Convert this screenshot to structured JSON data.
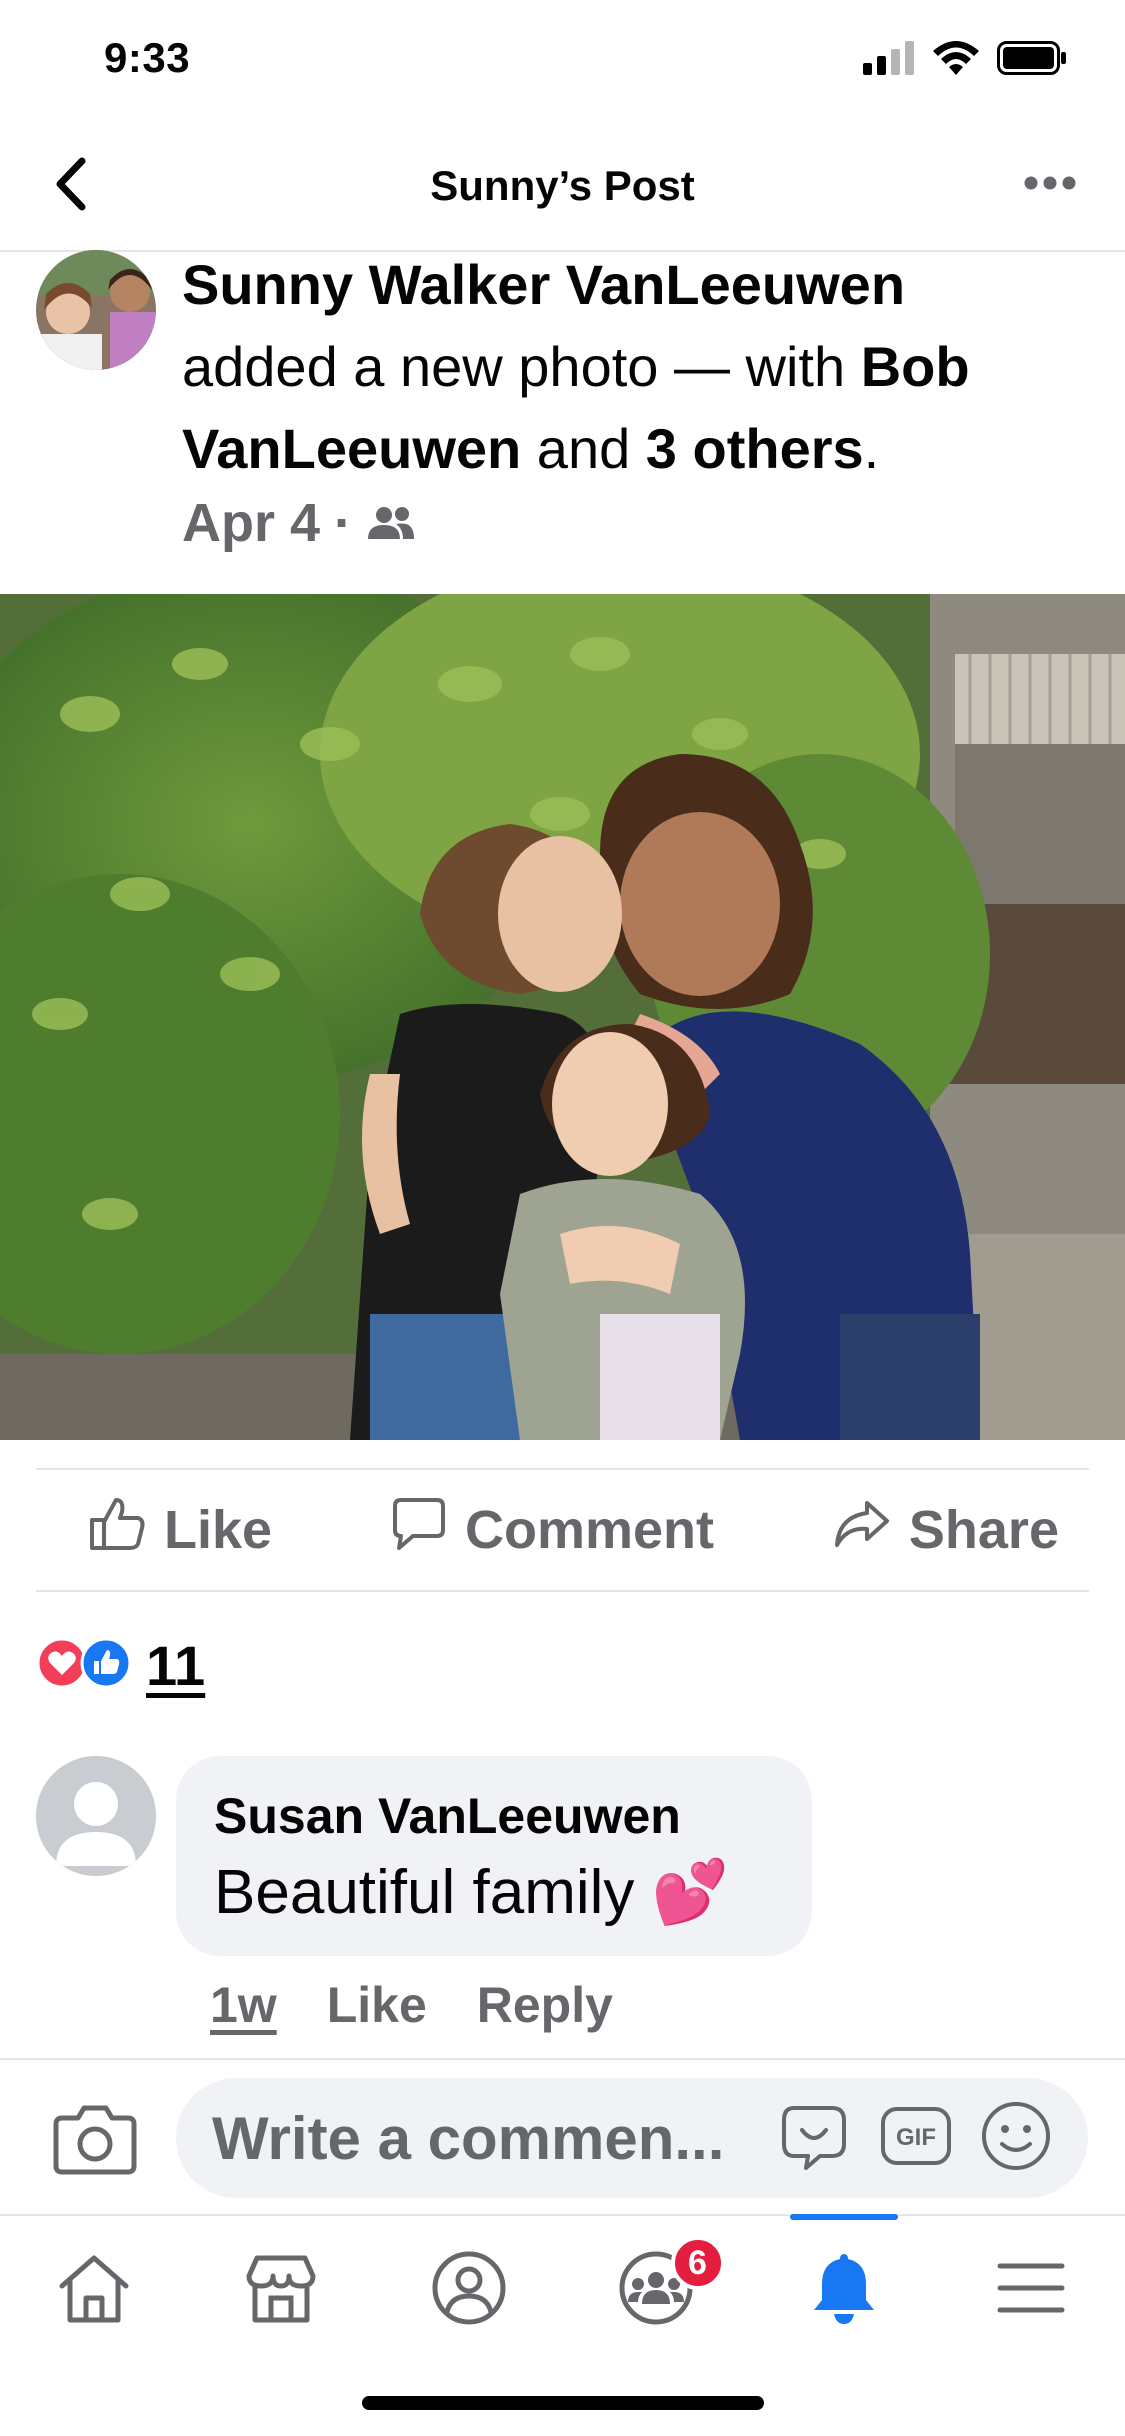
{
  "status_bar": {
    "time": "9:33"
  },
  "header": {
    "title": "Sunny’s Post",
    "back_icon": "chevron-left-icon",
    "more_icon": "ellipsis-icon"
  },
  "post": {
    "author": "Sunny Walker VanLeeuwen",
    "action_text": "added a new photo — with",
    "tagged_name": "Bob VanLeeuwen",
    "and_text": "and",
    "others": "3 others",
    "period": ".",
    "date": "Apr 4",
    "separator": "·",
    "audience_icon": "friends-icon"
  },
  "actions": {
    "like": "Like",
    "comment": "Comment",
    "share": "Share"
  },
  "reactions": {
    "count": "11",
    "types": [
      "love",
      "like"
    ]
  },
  "comment": {
    "author": "Susan VanLeeuwen",
    "text": "Beautiful family 💕",
    "time": "1w",
    "like": "Like",
    "reply": "Reply"
  },
  "composer": {
    "placeholder": "Write a commen..."
  },
  "tabs": [
    {
      "name": "home",
      "icon": "home-icon"
    },
    {
      "name": "marketplace",
      "icon": "store-icon"
    },
    {
      "name": "profile",
      "icon": "profile-icon"
    },
    {
      "name": "groups",
      "icon": "groups-icon",
      "badge": "6"
    },
    {
      "name": "notifications",
      "icon": "bell-icon",
      "active": true
    },
    {
      "name": "menu",
      "icon": "menu-icon"
    }
  ],
  "colors": {
    "accent": "#1877f2",
    "secondary_text": "#65676b",
    "badge": "#e41e3f",
    "love": "#f33e58"
  }
}
